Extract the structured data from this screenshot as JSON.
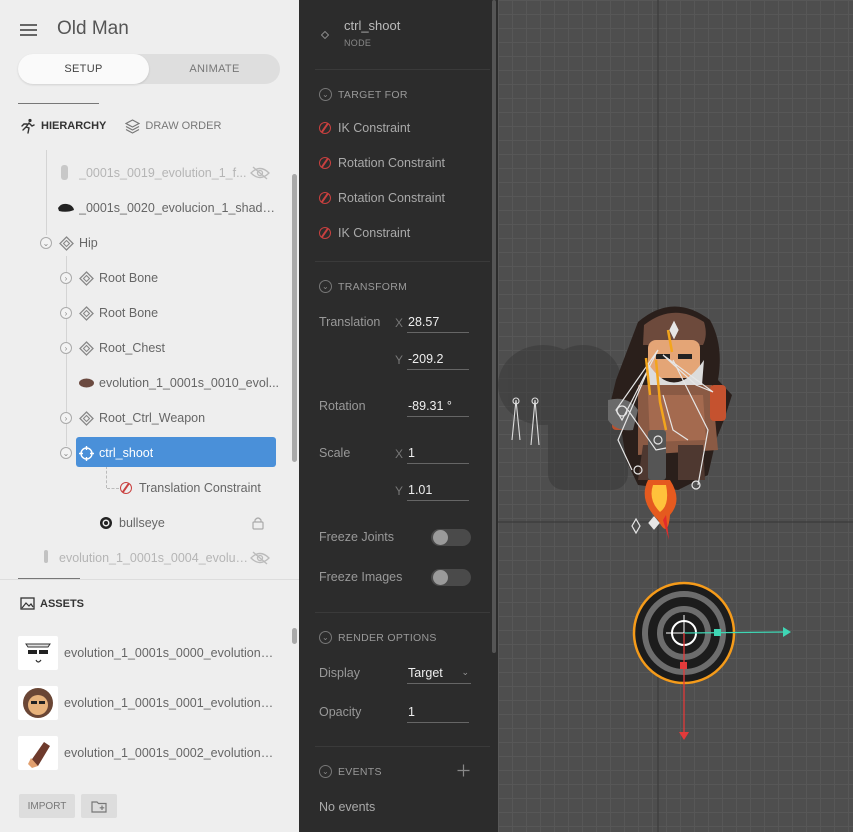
{
  "app": {
    "title": "Old Man"
  },
  "mode": {
    "setup": "SETUP",
    "animate": "ANIMATE",
    "active": "setup"
  },
  "tabs": {
    "hierarchy": "HIERARCHY",
    "draw_order": "DRAW ORDER"
  },
  "hierarchy": {
    "items": [
      {
        "label": "_0001s_0019_evolution_1_f...",
        "hidden": true
      },
      {
        "label": "_0001s_0020_evolucion_1_shado..."
      },
      {
        "label": "Hip"
      },
      {
        "label": "Root Bone"
      },
      {
        "label": "Root Bone"
      },
      {
        "label": "Root_Chest"
      },
      {
        "label": "evolution_1_0001s_0010_evol..."
      },
      {
        "label": "Root_Ctrl_Weapon"
      },
      {
        "label": "ctrl_shoot",
        "selected": true
      },
      {
        "label": "Translation Constraint"
      },
      {
        "label": "bullseye",
        "locked": true
      },
      {
        "label": "evolution_1_0001s_0004_evolut...",
        "hidden": true
      }
    ]
  },
  "assets": {
    "title": "ASSETS",
    "items": [
      {
        "label": "evolution_1_0001s_0000_evolution_f..."
      },
      {
        "label": "evolution_1_0001s_0001_evolution_..."
      },
      {
        "label": "evolution_1_0001s_0002_evolution_..."
      }
    ],
    "import_label": "IMPORT"
  },
  "inspector": {
    "node_name": "ctrl_shoot",
    "node_type": "NODE",
    "target_for": {
      "title": "TARGET FOR",
      "items": [
        "IK Constraint",
        "Rotation Constraint",
        "Rotation Constraint",
        "IK Constraint"
      ]
    },
    "transform": {
      "title": "TRANSFORM",
      "translation_label": "Translation",
      "translation_x": "28.57",
      "translation_y": "-209.2",
      "rotation_label": "Rotation",
      "rotation": "-89.31 °",
      "scale_label": "Scale",
      "scale_x": "1",
      "scale_y": "1.01",
      "x_axis": "X",
      "y_axis": "Y",
      "freeze_joints": "Freeze Joints",
      "freeze_images": "Freeze Images"
    },
    "render": {
      "title": "RENDER OPTIONS",
      "display_label": "Display",
      "display_value": "Target",
      "opacity_label": "Opacity",
      "opacity_value": "1"
    },
    "events": {
      "title": "EVENTS",
      "empty": "No events"
    }
  },
  "colors": {
    "selection": "#4a90d9",
    "constraint": "#c9403f",
    "target_ring": "#f59b1a",
    "axis_x": "#3fd6b4",
    "axis_y": "#e33a3a",
    "bone": "#f3a51c"
  }
}
